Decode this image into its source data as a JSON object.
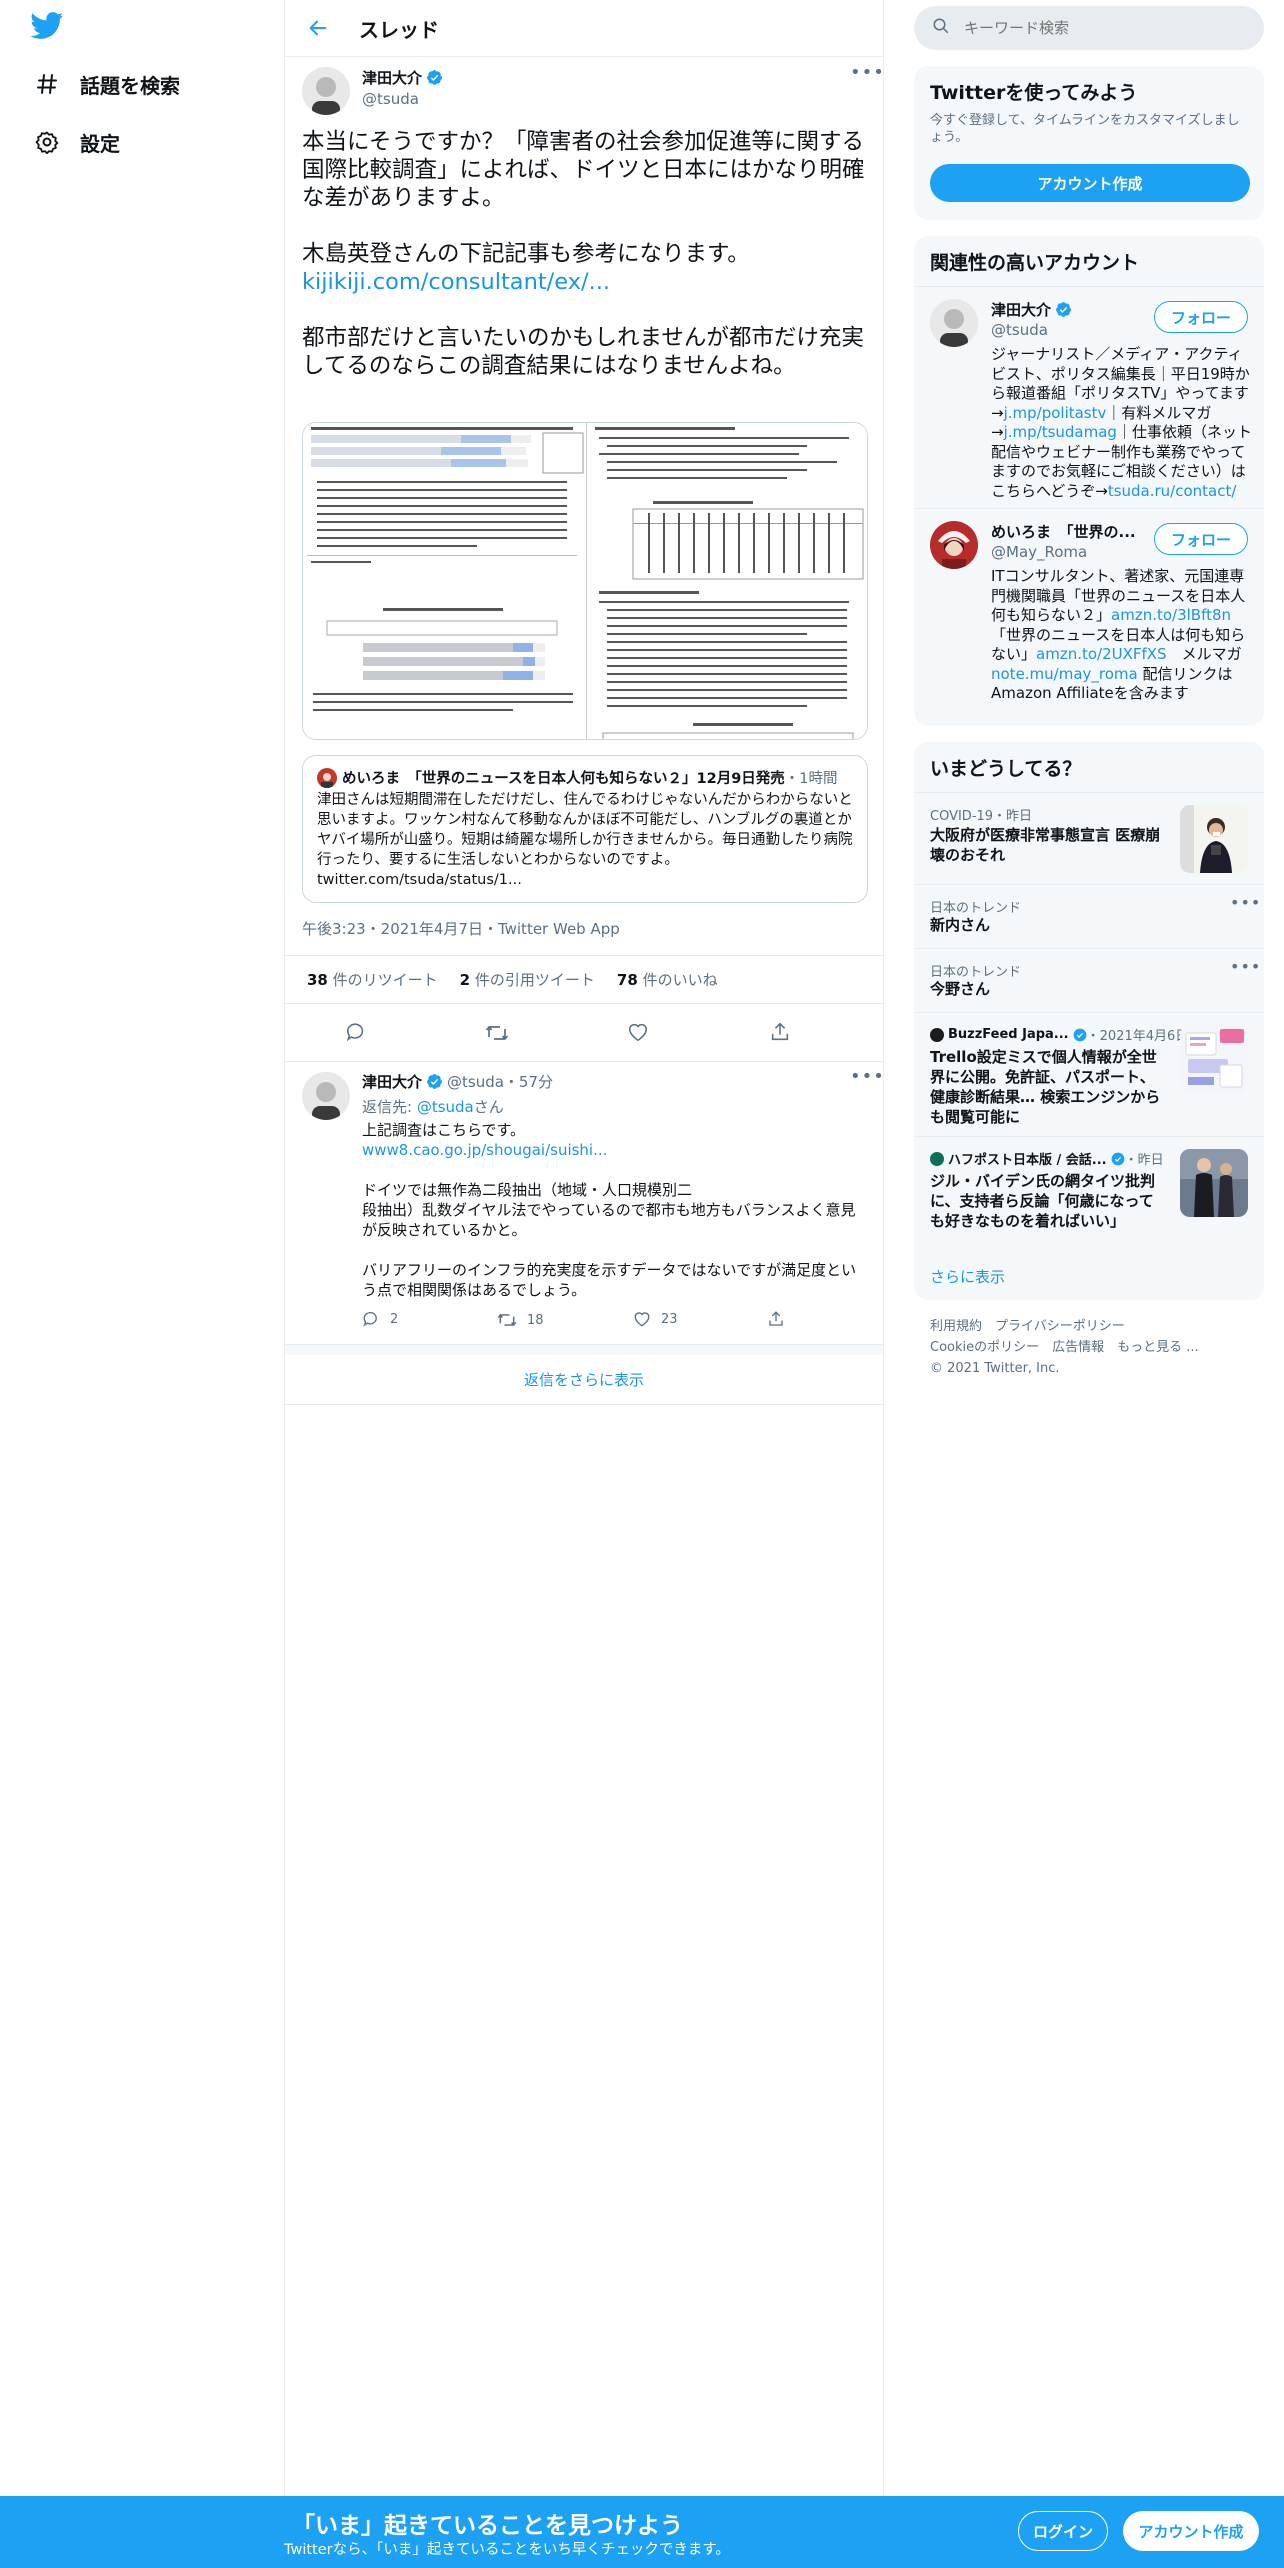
{
  "nav": {
    "explore_label": "話題を検索",
    "settings_label": "設定"
  },
  "header": {
    "title": "スレッド"
  },
  "main_tweet": {
    "name": "津田大介",
    "handle": "@tsuda",
    "text_1": "本当にそうですか？「障害者の社会参加促進等に関する国際比較調査」によれば、ドイツと日本にはかなり明確な差がありますよ。\n\n木島英登さんの下記記事も参考になります。",
    "link": "kijikiji.com/consultant/ex/...",
    "text_2": "都市部だけと言いたいのかもしれませんが都市だけ充実してるのならこの調査結果にはなりませんよね。",
    "timestamp": "午後3:23・2021年4月7日・Twitter Web App",
    "retweets_count": "38",
    "retweets_label": "件のリツイート",
    "quotes_count": "2",
    "quotes_label": "件の引用ツイート",
    "likes_count": "78",
    "likes_label": "件のいいね"
  },
  "quote_tweet": {
    "name": "めいろま　「世界のニュースを日本人何も知らない２」12月9日発売",
    "time": "・1時間",
    "text": "津田さんは短期間滞在しただけだし、住んでるわけじゃないんだからわからないと思いますよ。ワッケン村なんて移動なんかほぼ不可能だし、ハンブルグの裏道とかヤバイ場所が山盛り。短期は綺麗な場所しか行きませんから。毎日通勤したり病院行ったり、要するに生活しないとわからないのですよ。",
    "link": "twitter.com/tsuda/status/1..."
  },
  "reply_tweet": {
    "name": "津田大介",
    "handle_time": "@tsuda・57分",
    "reply_prefix": "返信先: ",
    "reply_to": "@tsuda",
    "reply_suffix": "さん",
    "text_1": "上記調査はこちらです。",
    "link": "www8.cao.go.jp/shougai/suishi...",
    "text_2": "ドイツでは無作為二段抽出（地域・人口規模別二\n段抽出）乱数ダイヤル法でやっているので都市も地方もバランスよく意見が反映されているかと。\n\nバリアフリーのインフラ的充実度を示すデータではないですが満足度という点で相関関係はあるでしょう。",
    "replies": "2",
    "retweets": "18",
    "likes": "23"
  },
  "show_more_replies": "返信をさらに表示",
  "search": {
    "placeholder": "キーワード検索"
  },
  "signup_card": {
    "title": "Twitterを使ってみよう",
    "subtitle": "今すぐ登録して、タイムラインをカスタマイズしましょう。",
    "button": "アカウント作成"
  },
  "related": {
    "title": "関連性の高いアカウント",
    "follow_label": "フォロー",
    "accounts": [
      {
        "name": "津田大介",
        "handle": "@tsuda",
        "bio_1": "ジャーナリスト／メディア・アクティビスト、ポリタス編集長｜平日19時から報道番組「ポリタスTV」やってます→",
        "link_1": "j.mp/politastv",
        "bio_2": "｜有料メルマガ→",
        "link_2": "j.mp/tsudamag",
        "bio_3": "｜仕事依頼（ネット配信やウェビナー制作も業務でやってますのでお気軽にご相談ください）はこちらへどうぞ→",
        "link_3": "tsuda.ru/contact/"
      },
      {
        "name": "めいろま　「世界の...",
        "handle": "@May_Roma",
        "bio_1": "ITコンサルタント、著述家、元国連専門機関職員「世界のニュースを日本人何も知らない２」",
        "link_1": "amzn.to/3lBft8n",
        "bio_2": "「世界のニュースを日本人は何も知らない」",
        "link_2": "amzn.to/2UXFfXS",
        "bio_3": "メルマガ",
        "link_3": "note.mu/may_roma",
        "bio_4": "配信リンクはAmazon Affiliateを含みます"
      }
    ]
  },
  "trends": {
    "title": "いまどうしてる？",
    "items": [
      {
        "meta": "COVID-19・昨日",
        "title": "大阪府が医療非常事態宣言 医療崩壊のおそれ"
      },
      {
        "meta": "日本のトレンド",
        "title": "新内さん"
      },
      {
        "meta": "日本のトレンド",
        "title": "今野さん"
      },
      {
        "meta_source": "BuzzFeed Japa...",
        "meta_date": "・2021年4月6日",
        "title": "Trello設定ミスで個人情報が全世界に公開。免許証、パスポート、健康診断結果… 検索エンジンからも閲覧可能に"
      },
      {
        "meta_source": "ハフポスト日本版 / 会話...",
        "meta_date": "・昨日",
        "title": "ジル・バイデン氏の網タイツ批判に、支持者ら反論「何歳になっても好きなものを着ればいい」"
      }
    ],
    "show_more": "さらに表示"
  },
  "footer": {
    "line_1": "利用規約　プライバシーポリシー",
    "line_2": "Cookieのポリシー　広告情報　もっと見る ...",
    "line_3": "© 2021 Twitter, Inc."
  },
  "bottom_bar": {
    "title": "「いま」起きていることを見つけよう",
    "subtitle": "Twitterなら、「いま」起きていることをいち早くチェックできます。",
    "login": "ログイン",
    "signup": "アカウント作成"
  },
  "colors": {
    "accent": "#1da1f2",
    "link": "#1b95e0",
    "secondary_text": "#5b7083"
  }
}
